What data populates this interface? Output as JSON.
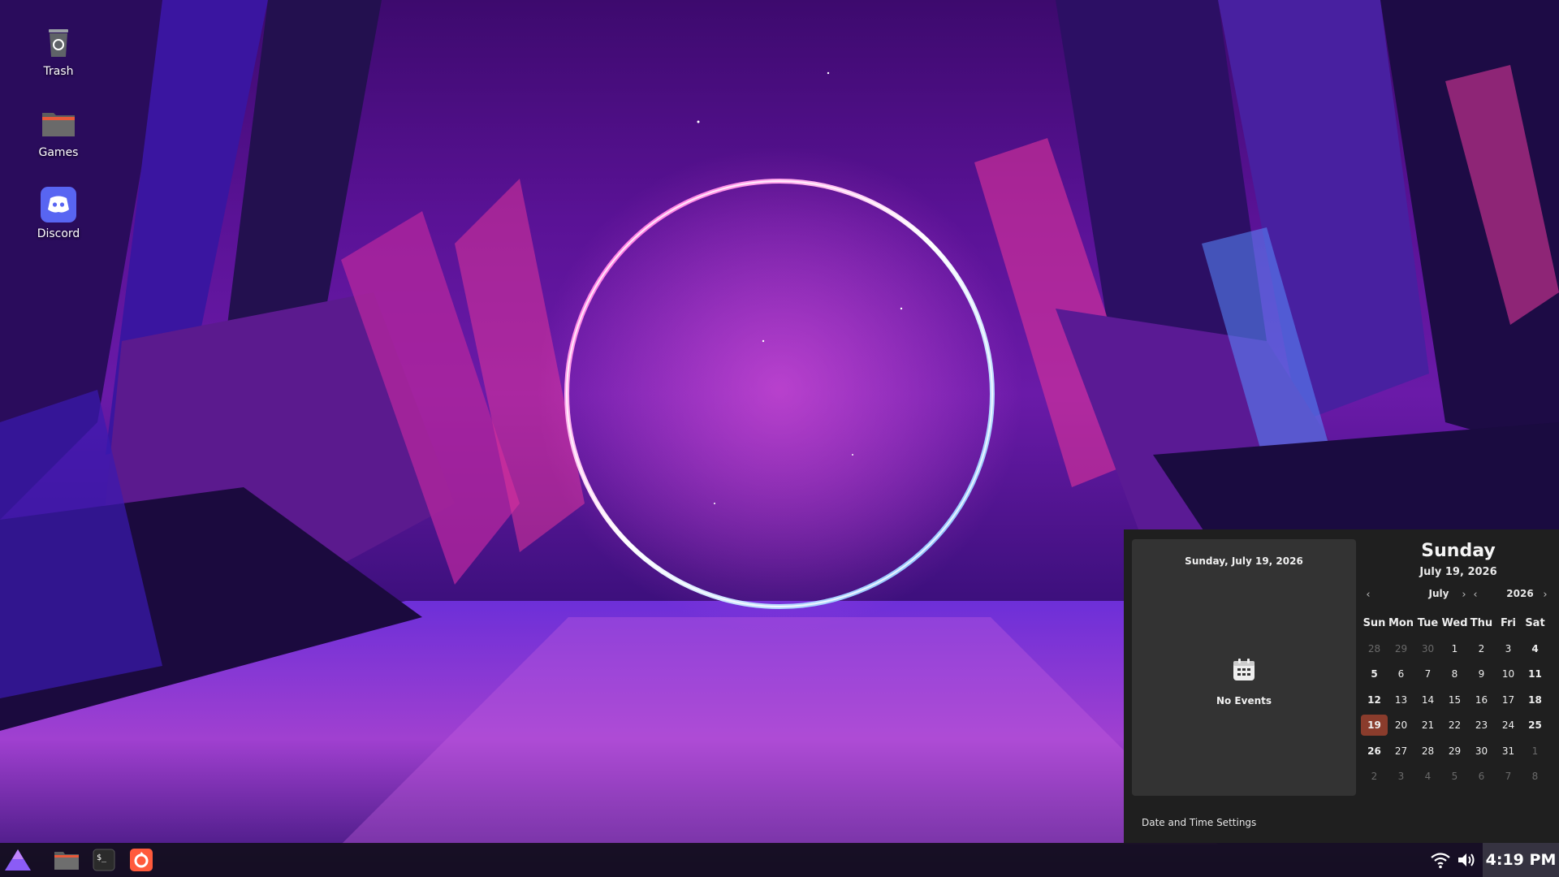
{
  "desktop": {
    "icons": [
      {
        "label": "Trash",
        "icon": "trash-icon"
      },
      {
        "label": "Games",
        "icon": "folder-icon"
      },
      {
        "label": "Discord",
        "icon": "discord-icon"
      }
    ]
  },
  "taskbar": {
    "launchers": [
      {
        "icon": "app-menu-icon"
      },
      {
        "icon": "file-manager-icon"
      },
      {
        "icon": "terminal-icon"
      },
      {
        "icon": "firefox-icon"
      }
    ],
    "tray": {
      "clock": "4:19 PM",
      "wifi_icon": "wifi-icon",
      "volume_icon": "volume-icon"
    }
  },
  "calendar_popup": {
    "events_header": "Sunday, July 19, 2026",
    "no_events": "No Events",
    "big_day": "Sunday",
    "big_date": "July 19, 2026",
    "month": "July",
    "year": "2026",
    "weekdays": [
      "Sun",
      "Mon",
      "Tue",
      "Wed",
      "Thu",
      "Fri",
      "Sat"
    ],
    "weeks": [
      [
        "28",
        "29",
        "30",
        "1",
        "2",
        "3",
        "4"
      ],
      [
        "5",
        "6",
        "7",
        "8",
        "9",
        "10",
        "11"
      ],
      [
        "12",
        "13",
        "14",
        "15",
        "16",
        "17",
        "18"
      ],
      [
        "19",
        "20",
        "21",
        "22",
        "23",
        "24",
        "25"
      ],
      [
        "26",
        "27",
        "28",
        "29",
        "30",
        "31",
        "1"
      ],
      [
        "2",
        "3",
        "4",
        "5",
        "6",
        "7",
        "8"
      ]
    ],
    "today": "19",
    "settings_link": "Date and Time Settings",
    "colors": {
      "today_highlight": "#8a3c2c",
      "popup_bg": "#1f1f1f",
      "events_pane_bg": "#333333"
    }
  }
}
